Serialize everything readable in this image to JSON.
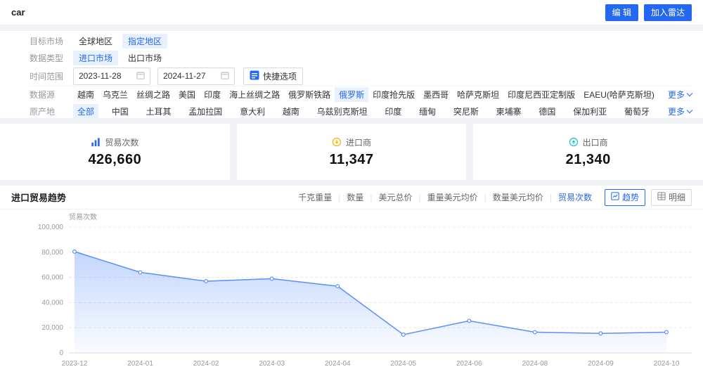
{
  "header": {
    "title": "car",
    "edit_button": "编 辑",
    "radar_button": "加入雷达"
  },
  "filters": {
    "target_market": {
      "label": "目标市场",
      "options": [
        "全球地区",
        "指定地区"
      ],
      "selected": "指定地区"
    },
    "data_type": {
      "label": "数据类型",
      "options": [
        "进口市场",
        "出口市场"
      ],
      "selected": "进口市场"
    },
    "time_range": {
      "label": "时间范围",
      "start": "2023-11-28",
      "end": "2024-11-27",
      "quick_label": "快捷选项"
    },
    "data_source": {
      "label": "数据源",
      "options": [
        "越南",
        "乌克兰",
        "丝绸之路",
        "美国",
        "印度",
        "海上丝绸之路",
        "俄罗斯铁路",
        "俄罗斯",
        "印度抢先版",
        "墨西哥",
        "哈萨克斯坦",
        "印度尼西亚定制版",
        "EAEU(哈萨克斯坦)"
      ],
      "selected": "俄罗斯",
      "more_label": "更多"
    },
    "origin": {
      "label": "原产地",
      "options": [
        "全部",
        "中国",
        "土耳其",
        "孟加拉国",
        "意大利",
        "越南",
        "乌兹别克斯坦",
        "印度",
        "缅甸",
        "突尼斯",
        "柬埔寨",
        "德国",
        "保加利亚",
        "葡萄牙"
      ],
      "selected": "全部",
      "more_label": "更多"
    }
  },
  "stats": [
    {
      "label": "贸易次数",
      "value": "426,660",
      "icon": "bar-chart-icon",
      "color": "#2468f2"
    },
    {
      "label": "进口商",
      "value": "11,347",
      "icon": "importer-icon",
      "color": "#f7b500"
    },
    {
      "label": "出口商",
      "value": "21,340",
      "icon": "exporter-icon",
      "color": "#13c2c2"
    }
  ],
  "chart_section": {
    "title": "进口贸易趋势",
    "metrics": [
      "千克重量",
      "数量",
      "美元总价",
      "重量美元均价",
      "数量美元均价",
      "贸易次数"
    ],
    "selected_metric": "贸易次数",
    "trend_button": "趋势",
    "detail_button": "明细"
  },
  "chart_data": {
    "type": "line",
    "title": "进口贸易趋势",
    "x": [
      "2023-12",
      "2024-01",
      "2024-02",
      "2024-03",
      "2024-04",
      "2024-05",
      "2024-06",
      "2024-08",
      "2024-09",
      "2024-10"
    ],
    "values": [
      80500,
      64000,
      57000,
      59000,
      53000,
      14500,
      25500,
      16500,
      15500,
      16500
    ],
    "ylabel": "贸易次数",
    "ylim": [
      0,
      100000
    ],
    "yticks": [
      0,
      20000,
      40000,
      60000,
      80000,
      100000
    ],
    "grid": true,
    "legend_position": "none",
    "line_color": "#5b8ff9",
    "area": true
  },
  "colors": {
    "primary": "#2468f2",
    "selected_bg": "#e9f1ff"
  }
}
